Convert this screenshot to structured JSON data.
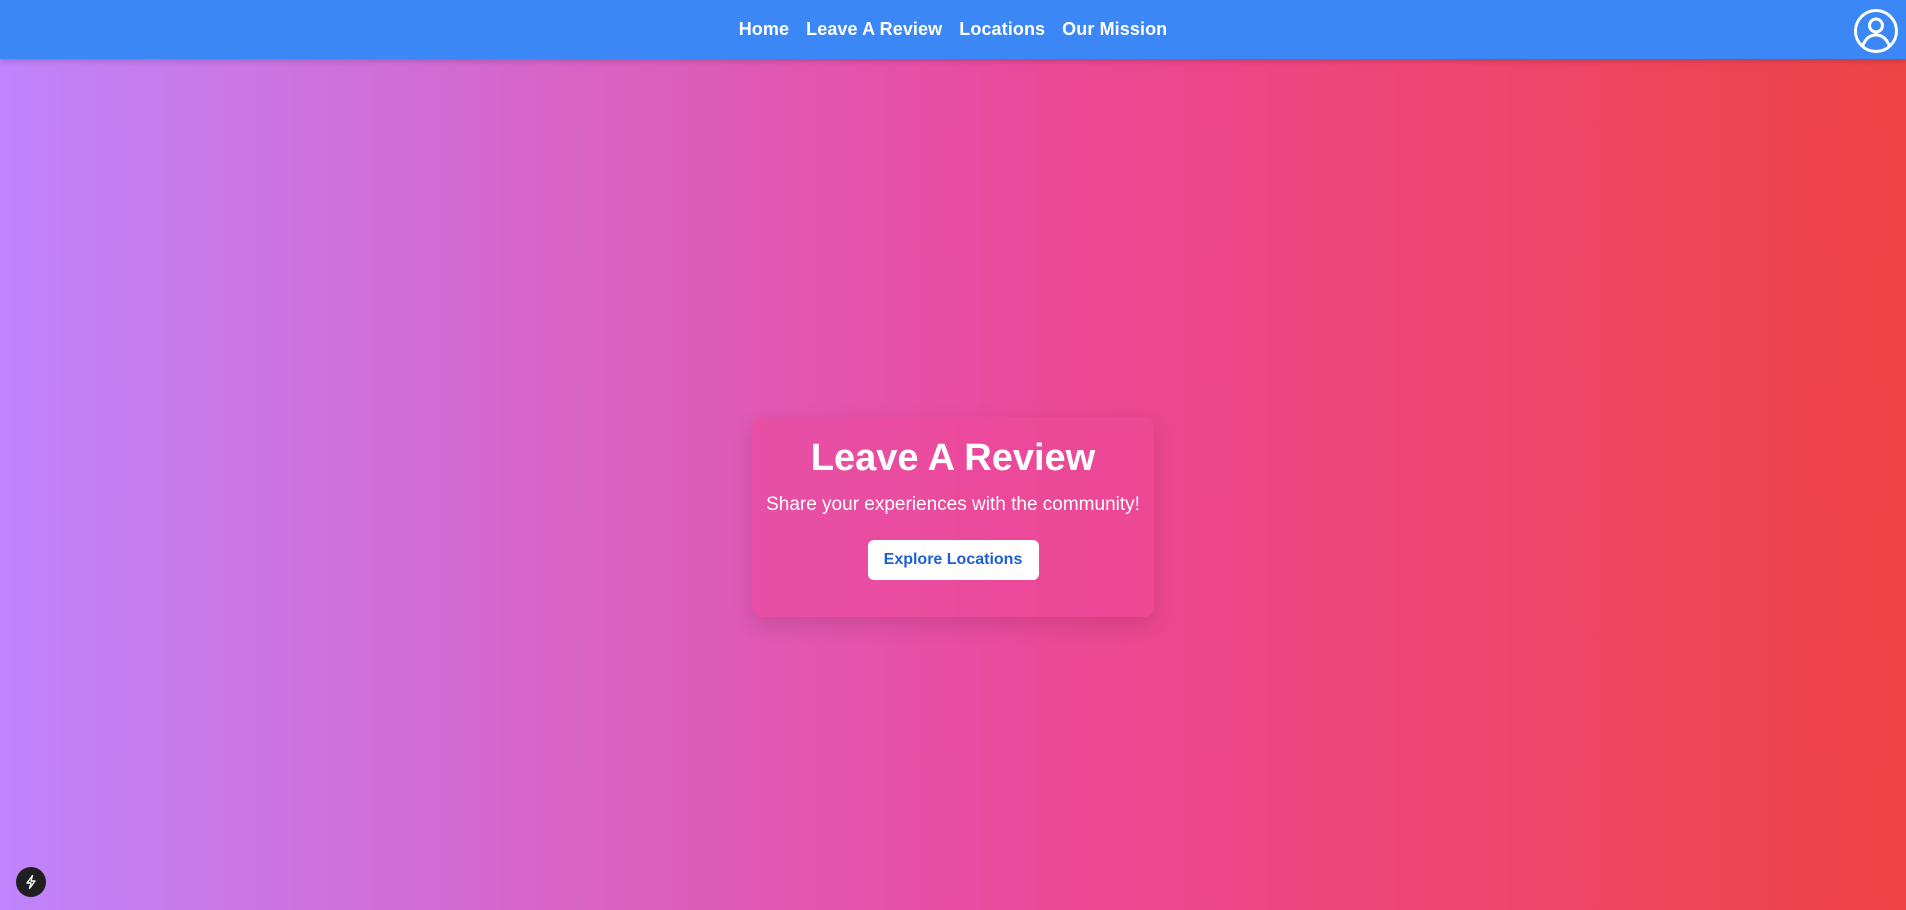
{
  "nav": {
    "links": [
      {
        "label": "Home"
      },
      {
        "label": "Leave A Review"
      },
      {
        "label": "Locations"
      },
      {
        "label": "Our Mission"
      }
    ],
    "profile_icon": "user-circle-icon"
  },
  "hero": {
    "title": "Leave A Review",
    "subtitle": "Share your experiences with the community!",
    "button_label": "Explore Locations"
  },
  "badge": {
    "icon": "lightning-bolt-icon"
  },
  "colors": {
    "navbar": "#3b87f6",
    "gradient_start": "#c084fc",
    "gradient_mid": "#ec4899",
    "gradient_end": "#ef4444",
    "button_text": "#1d5fd6"
  }
}
